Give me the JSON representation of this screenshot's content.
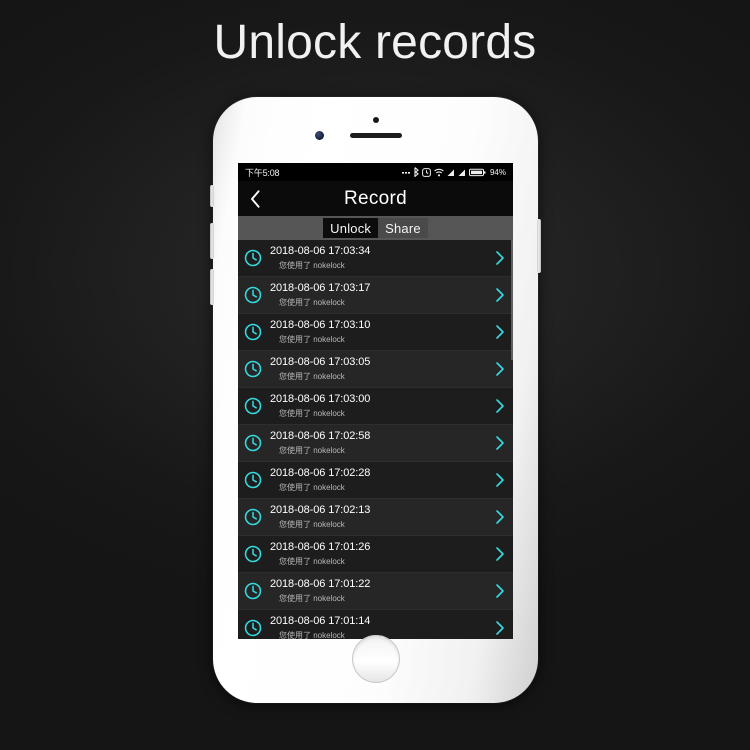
{
  "page": {
    "headline": "Unlock records",
    "background_color": "#1a1a1a",
    "accent_color": "#35dbe0"
  },
  "phone": {
    "frame_color": "#ffffff",
    "buttons": {
      "silent_switch": "silent-switch",
      "volume_up": "volume-up",
      "volume_down": "volume-down",
      "power": "power"
    }
  },
  "statusbar": {
    "time": "下午5:08",
    "battery_percent": "94%",
    "icons": [
      "more-icon",
      "bluetooth-icon",
      "alarm-icon",
      "wifi-icon",
      "signal-icon",
      "signal-icon",
      "battery-icon"
    ]
  },
  "navbar": {
    "back_icon": "chevron-left-icon",
    "title": "Record"
  },
  "tabs": {
    "selected": "Unlock",
    "items": [
      {
        "label": "Unlock",
        "active": true
      },
      {
        "label": "Share",
        "active": false
      }
    ]
  },
  "records": {
    "subtitle_text": "您使用了 nokelock",
    "items": [
      {
        "timestamp": "2018-08-06 17:03:34",
        "detail": "您使用了 nokelock"
      },
      {
        "timestamp": "2018-08-06 17:03:17",
        "detail": "您使用了 nokelock"
      },
      {
        "timestamp": "2018-08-06 17:03:10",
        "detail": "您使用了 nokelock"
      },
      {
        "timestamp": "2018-08-06 17:03:05",
        "detail": "您使用了 nokelock"
      },
      {
        "timestamp": "2018-08-06 17:03:00",
        "detail": "您使用了 nokelock"
      },
      {
        "timestamp": "2018-08-06 17:02:58",
        "detail": "您使用了 nokelock"
      },
      {
        "timestamp": "2018-08-06 17:02:28",
        "detail": "您使用了 nokelock"
      },
      {
        "timestamp": "2018-08-06 17:02:13",
        "detail": "您使用了 nokelock"
      },
      {
        "timestamp": "2018-08-06 17:01:26",
        "detail": "您使用了 nokelock"
      },
      {
        "timestamp": "2018-08-06 17:01:22",
        "detail": "您使用了 nokelock"
      },
      {
        "timestamp": "2018-08-06 17:01:14",
        "detail": "您使用了 nokelock"
      }
    ]
  }
}
